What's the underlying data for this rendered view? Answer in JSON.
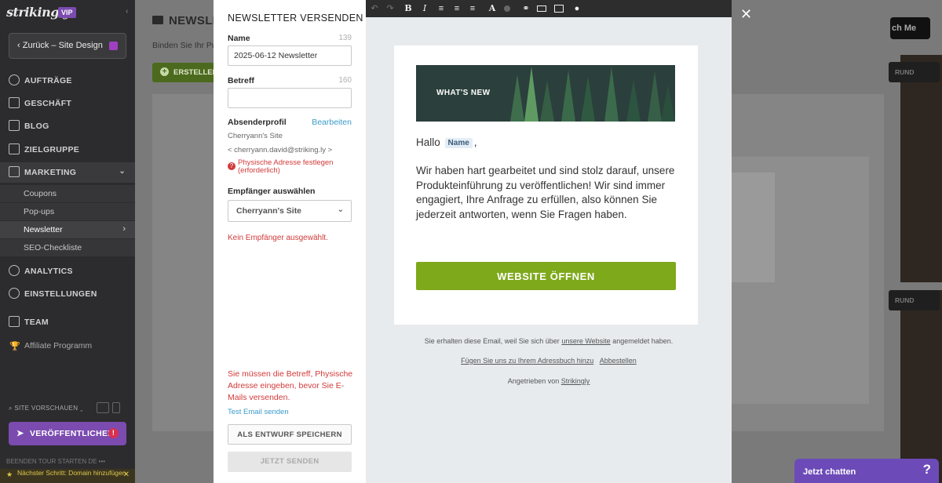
{
  "sidebar": {
    "logo": "strikingly",
    "vip": "VIP",
    "back": "Zurück – Site Design",
    "nav": [
      "AUFTRÄGE",
      "GESCHÄFT",
      "BLOG",
      "ZIELGRUPPE",
      "MARKETING"
    ],
    "sub": [
      "Coupons",
      "Pop-ups",
      "Newsletter",
      "SEO-Checkliste"
    ],
    "nav2": [
      "ANALYTICS",
      "EINSTELLUNGEN",
      "TEAM"
    ],
    "affiliate": "Affiliate Programm",
    "site_preview": "SITE VORSCHAUEN",
    "publish": "VERÖFFENTLICHEN",
    "tour": "BEENDEN  TOUR STARTEN  DE  •••",
    "next_step": "Nächster Schritt: Domain hinzufügen"
  },
  "page": {
    "title": "NEWSLETTER",
    "description": "Binden Sie Ihr Pu",
    "create": "ERSTELLEN",
    "launch": "ch Me",
    "right_btn": "RUND"
  },
  "form": {
    "title": "NEWSLETTER VERSENDEN",
    "name_label": "Name",
    "name_count": "139",
    "name_value": "2025-06-12 Newsletter",
    "subject_label": "Betreff",
    "subject_count": "160",
    "subject_value": "",
    "sender_label": "Absenderprofil",
    "edit": "Bearbeiten",
    "sender_name": "Cherryann's Site",
    "sender_email": "< cherryann.david@striking.ly >",
    "address_error": "Physische Adresse festlegen (erforderlich)",
    "recipient_label": "Empfänger auswählen",
    "recipient_value": "Cherryann's Site",
    "no_recipient": "Kein Empfänger ausgewählt.",
    "validation": "Sie müssen die Betreff, Physische Adresse eingeben, bevor Sie E-Mails versenden.",
    "test_email": "Test Email senden",
    "save_draft": "ALS ENTWURF SPEICHERN",
    "send_now": "JETZT SENDEN"
  },
  "editor": {
    "toolbar_icons": [
      "undo-icon",
      "redo-icon",
      "bold-icon",
      "italic-icon",
      "align-left-icon",
      "align-center-icon",
      "align-right-icon",
      "text-color-icon",
      "color-dot-icon",
      "link-icon",
      "button-icon",
      "image-icon",
      "user-icon"
    ],
    "bold": "B",
    "italic": "I",
    "textcolor": "A",
    "banner_text": "WHAT'S NEW",
    "greeting": "Hallo",
    "name_tag": "Name",
    "comma": ",",
    "body": "Wir haben hart gearbeitet und sind stolz darauf, unsere Produkteinführung zu veröffentlichen! Wir sind immer  engagiert, Ihre Anfrage zu erfüllen, also können Sie jederzeit antworten, wenn Sie Fragen haben.",
    "cta": "WEBSITE ÖFFNEN",
    "footer1_pre": "Sie erhalten diese Email, weil Sie sich über ",
    "footer1_link": "unsere Website",
    "footer1_post": " angemeldet haben.",
    "footer2_link1": "Fügen Sie uns zu Ihrem Adressbuch hinzu",
    "footer2_link2": "Abbestellen",
    "footer3_pre": "Angetrieben von ",
    "footer3_link": "Strikingly"
  },
  "chat": {
    "label": "Jetzt chatten",
    "icon": "?"
  },
  "colors": {
    "accent_green": "#7ea91b",
    "purple": "#7b4bb0",
    "error": "#d23a3a",
    "link": "#3a9bc8"
  }
}
